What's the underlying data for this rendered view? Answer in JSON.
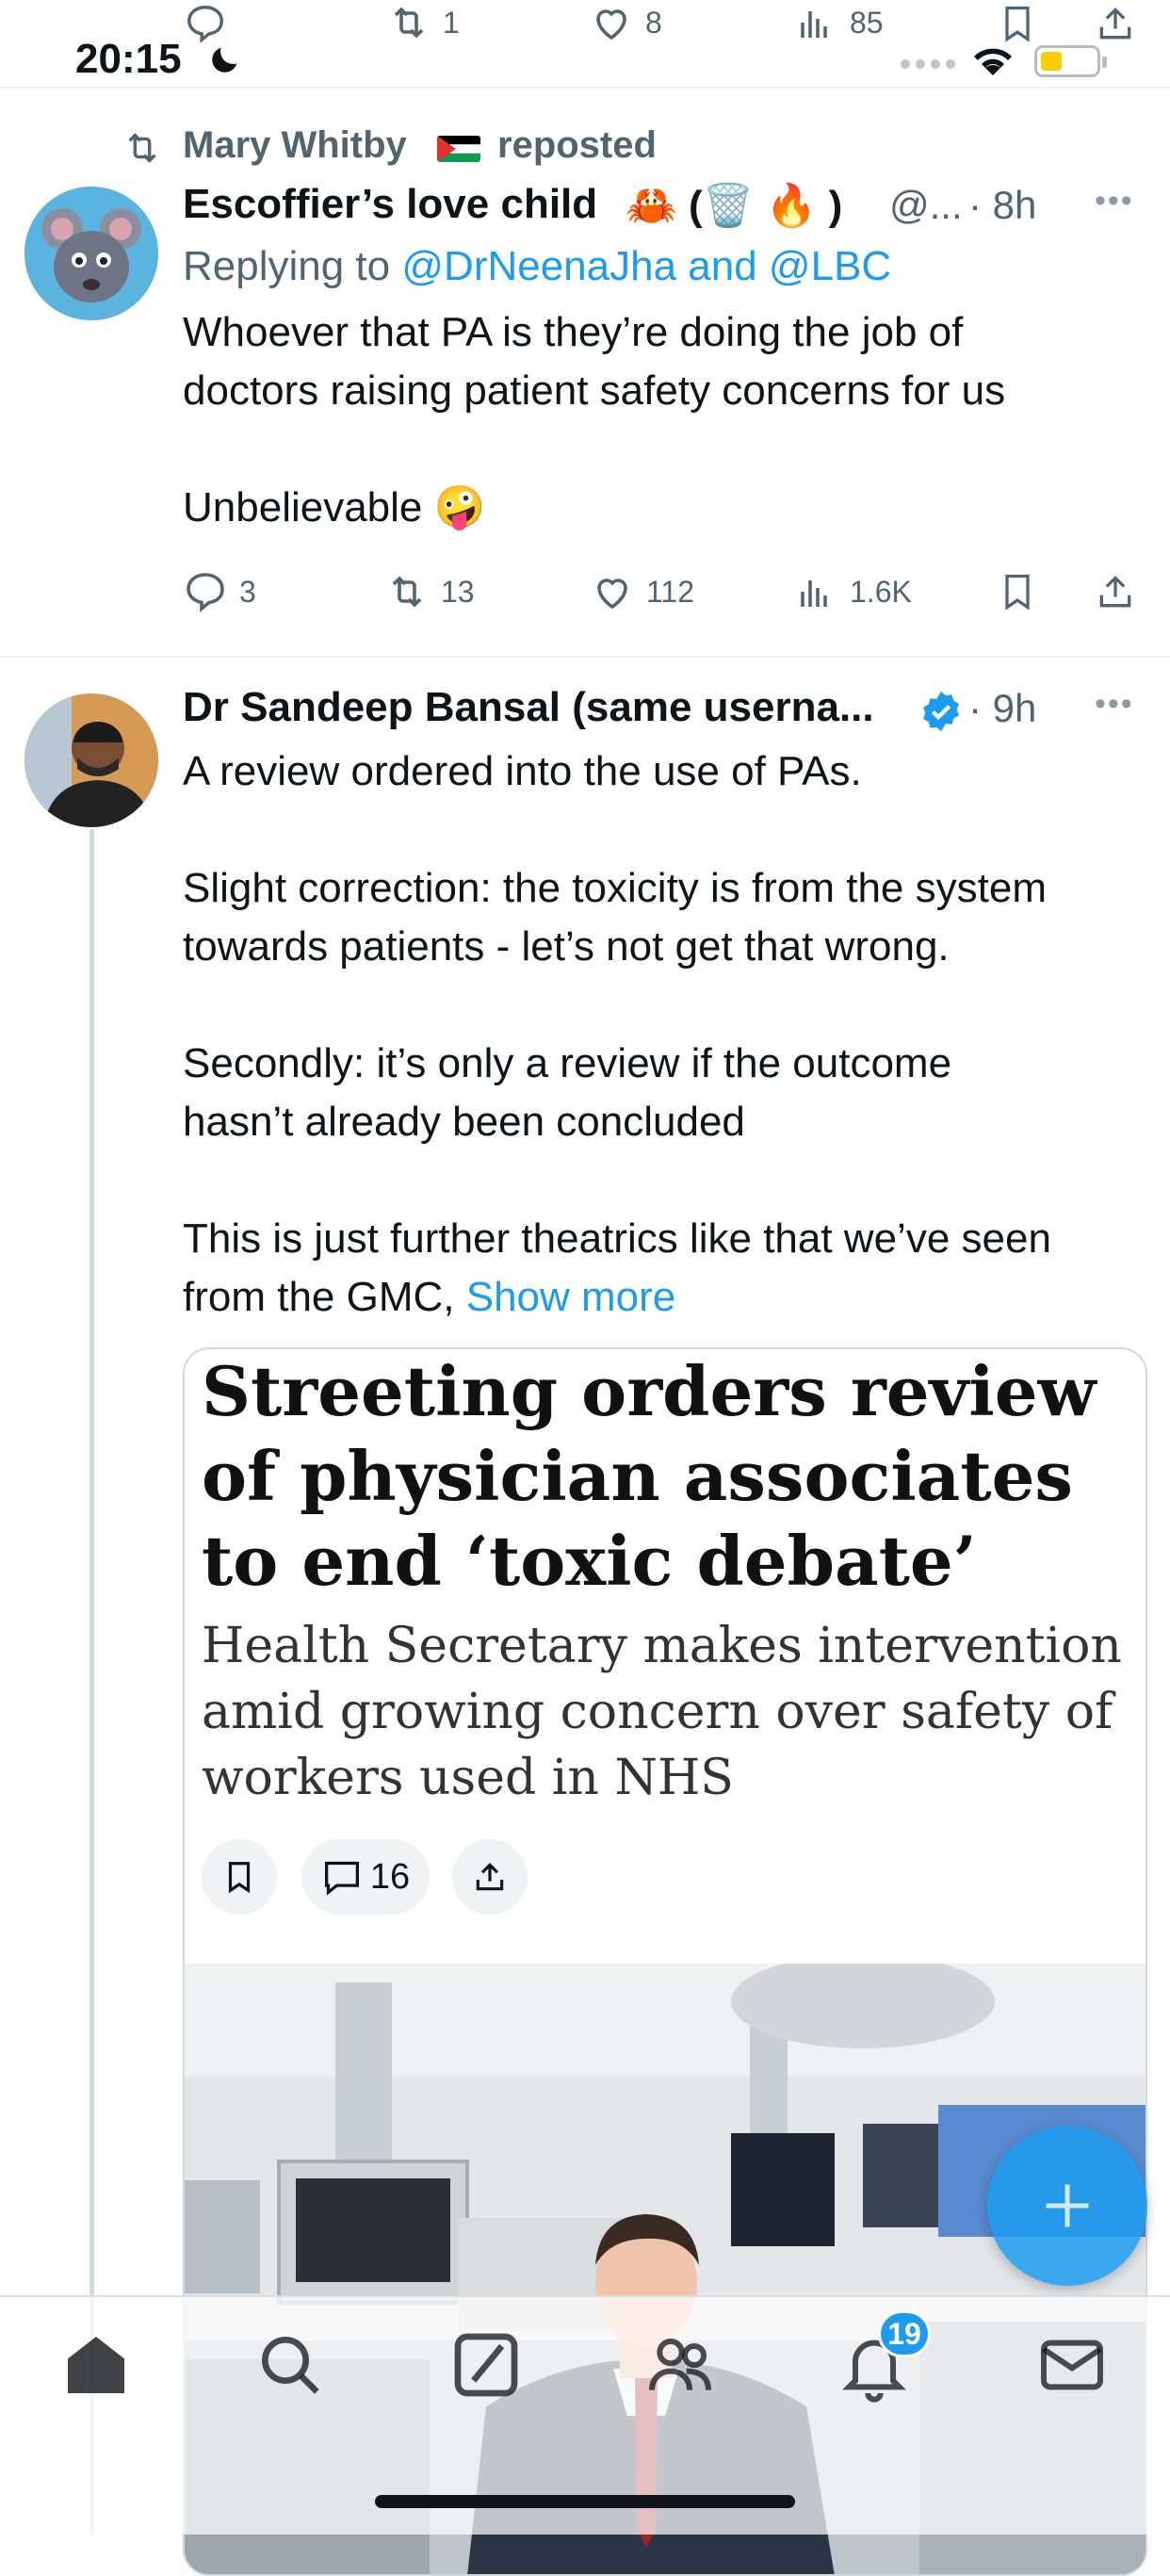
{
  "status_bar": {
    "time": "20:15"
  },
  "top_stats": {
    "reply": "",
    "retweets": "1",
    "likes": "8",
    "views": "85"
  },
  "tweet1": {
    "repost_by": "Mary Whitby",
    "repost_label": "reposted",
    "author": "Escoffier’s love child",
    "emoji_decoration": "🦀 (🗑️ 🔥 )",
    "handle": "@...",
    "time": "· 8h",
    "replying_prefix": "Replying to",
    "replying_to": "@DrNeenaJha and @LBC",
    "body_line1": "Whoever that PA is they’re doing the job of",
    "body_line2": "doctors raising patient safety concerns for us",
    "body_line3": "Unbelievable 🤪",
    "stats": {
      "replies": "3",
      "retweets": "13",
      "likes": "112",
      "views": "1.6K"
    }
  },
  "tweet2": {
    "author": "Dr Sandeep Bansal (same userna...",
    "time": "· 9h",
    "para1": "A review ordered into the use of PAs.",
    "para2_l1": "Slight correction: the toxicity is from the system",
    "para2_l2": "towards patients - let’s not get that wrong.",
    "para3_l1": "Secondly: it’s only a review if the outcome",
    "para3_l2": "hasn’t already been concluded",
    "para4_l1": "This is just further theatrics like that we’ve seen",
    "para4_l2": "from the GMC,",
    "show_more": "Show more",
    "article": {
      "headline": "Streeting orders review of physician associates to end ‘toxic debate’",
      "subhead": "Health Secretary makes intervention amid growing concern over safety of workers used in NHS",
      "comments": "16"
    }
  },
  "nav": {
    "notifications_badge": "19"
  },
  "colors": {
    "accent": "#1d9bf0",
    "muted": "#536471",
    "verified": "#1d9bf0"
  }
}
